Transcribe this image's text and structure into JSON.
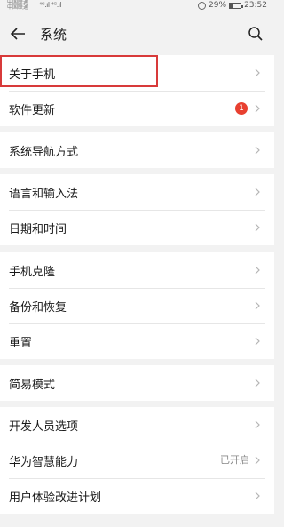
{
  "status_bar": {
    "carrier_line1": "中国联通",
    "carrier_line2": "中国联通",
    "signal": "⁴ᴳ.ıl ⁴ᴳ.ıl",
    "battery": "29%",
    "time": "23:52"
  },
  "header": {
    "title": "系统"
  },
  "groups": [
    {
      "items": [
        {
          "label": "关于手机"
        },
        {
          "label": "软件更新",
          "badge": "1"
        }
      ]
    },
    {
      "items": [
        {
          "label": "系统导航方式"
        }
      ]
    },
    {
      "items": [
        {
          "label": "语言和输入法"
        },
        {
          "label": "日期和时间"
        }
      ]
    },
    {
      "items": [
        {
          "label": "手机克隆"
        },
        {
          "label": "备份和恢复"
        },
        {
          "label": "重置"
        }
      ]
    },
    {
      "items": [
        {
          "label": "简易模式"
        }
      ]
    },
    {
      "items": [
        {
          "label": "开发人员选项"
        },
        {
          "label": "华为智慧能力",
          "value": "已开启"
        },
        {
          "label": "用户体验改进计划"
        }
      ]
    }
  ],
  "colors": {
    "accent_highlight": "#d83a3a",
    "badge": "#e84030"
  }
}
